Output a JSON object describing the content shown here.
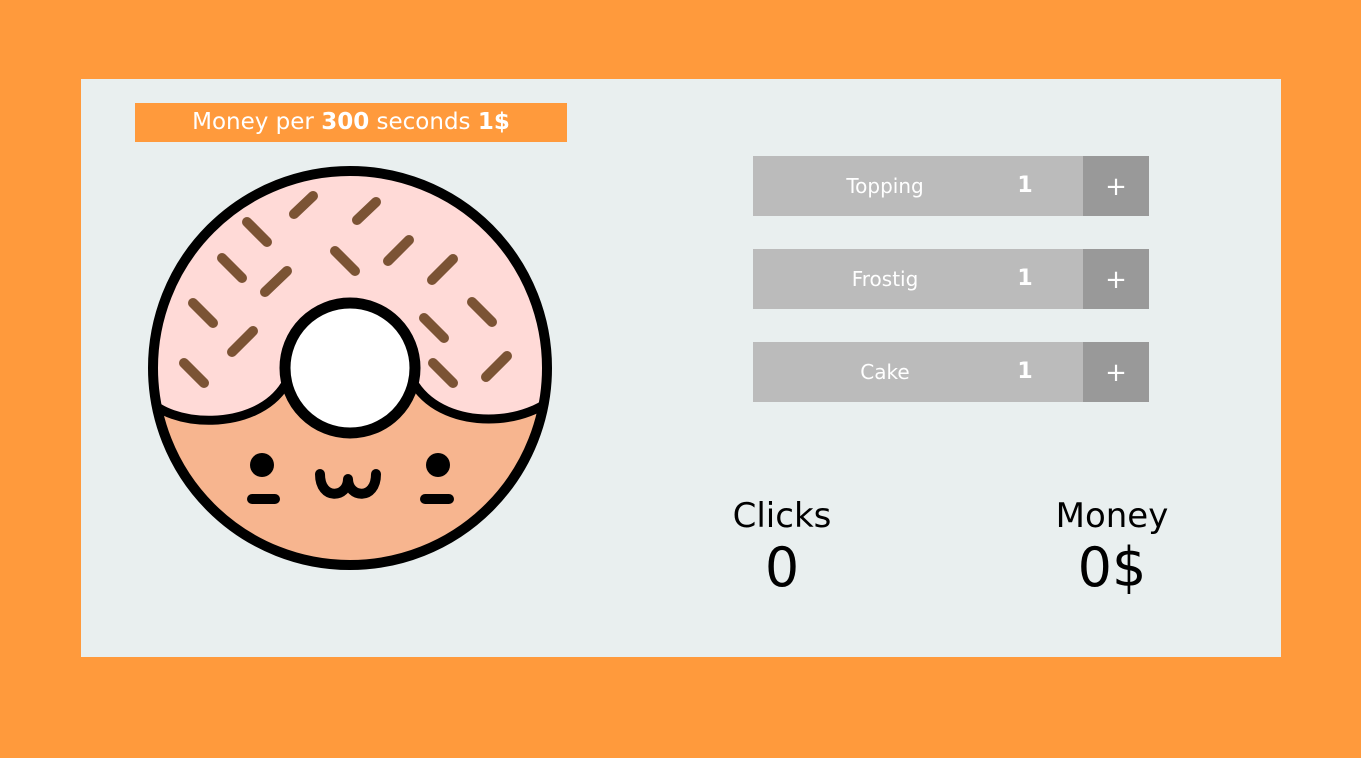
{
  "banner": {
    "prefix": "Money per",
    "seconds": "300",
    "middle": "seconds",
    "amount": "1$"
  },
  "upgrades": [
    {
      "name": "Topping",
      "level": "1",
      "button": "+"
    },
    {
      "name": "Frostig",
      "level": "1",
      "button": "+"
    },
    {
      "name": "Cake",
      "level": "1",
      "button": "+"
    }
  ],
  "stats": {
    "clicks_label": "Clicks",
    "clicks_value": "0",
    "money_label": "Money",
    "money_value": "0$"
  },
  "icons": {
    "donut": "donut-face-icon",
    "plus": "plus-icon"
  },
  "colors": {
    "background": "#FF9A3C",
    "panel": "#E9EFEF",
    "upgrade_info": "#BBBBBB",
    "upgrade_button": "#999999",
    "frosting": "#FFDAD7",
    "dough": "#F7B58F",
    "sprinkle": "#7B5334"
  }
}
